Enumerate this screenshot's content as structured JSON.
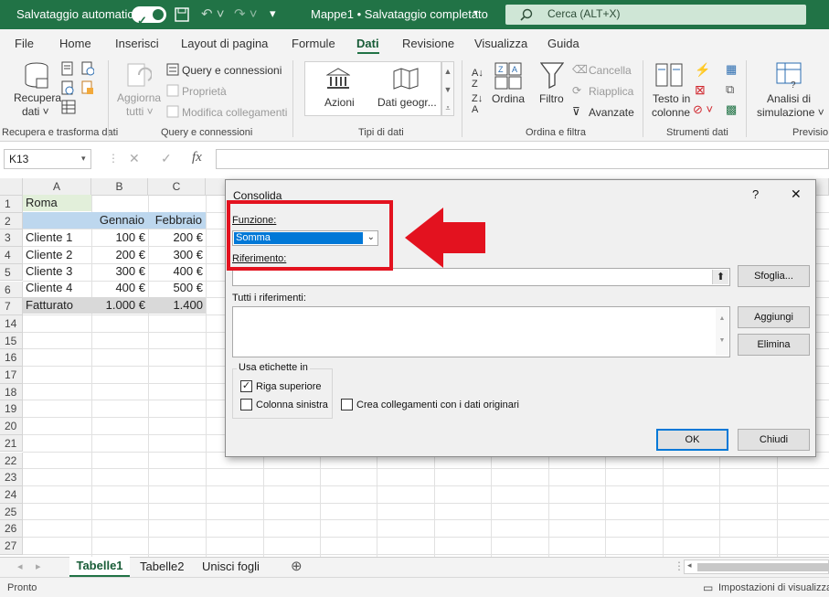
{
  "titlebar": {
    "autosave_label": "Salvataggio automatico",
    "doc_title": "Mappe1 • Salvataggio completato",
    "search_placeholder": "Cerca (ALT+X)",
    "colors": {
      "bar": "#217346"
    }
  },
  "tabs": [
    "File",
    "Home",
    "Inserisci",
    "Layout di pagina",
    "Formule",
    "Dati",
    "Revisione",
    "Visualizza",
    "Guida"
  ],
  "active_tab": "Dati",
  "ribbon": {
    "recupera": {
      "line1": "Recupera",
      "line2": "dati ˅"
    },
    "query": {
      "q1": "Query e connessioni",
      "q2": "Proprietà",
      "q3": "Modifica collegamenti",
      "agg1": "Aggiorna",
      "agg2": "tutti ˅"
    },
    "tipi": {
      "azioni": "Azioni",
      "geo": "Dati geogr..."
    },
    "sort": {
      "ordina": "Ordina",
      "filtro": "Filtro",
      "cancella": "Cancella",
      "riapplica": "Riapplica",
      "avanzate": "Avanzate"
    },
    "tools": {
      "testo1": "Testo in",
      "testo2": "colonne"
    },
    "analisi": {
      "line1": "Analisi di",
      "line2": "simulazione ˅"
    },
    "groups": [
      "Recupera e trasforma dati",
      "Query e connessioni",
      "Tipi di dati",
      "Ordina e filtra",
      "Strumenti dati",
      "Previsio"
    ]
  },
  "formula_bar": {
    "name_box": "K13",
    "cancel": "✕",
    "enter": "✓",
    "fx": "fx"
  },
  "grid": {
    "columns": [
      "A",
      "B",
      "C"
    ],
    "rows": [
      "1",
      "2",
      "3",
      "4",
      "5",
      "6",
      "7",
      "14",
      "15",
      "16",
      "17",
      "18",
      "19",
      "20",
      "21",
      "22",
      "23",
      "24",
      "25",
      "26",
      "27"
    ],
    "header_row": {
      "b": "Gennaio",
      "c": "Febbraio"
    },
    "a1": "Roma",
    "data": [
      {
        "a": "Cliente 1",
        "b": "100 €",
        "c": "200 €"
      },
      {
        "a": "Cliente 2",
        "b": "200 €",
        "c": "300 €"
      },
      {
        "a": "Cliente 3",
        "b": "300 €",
        "c": "400 €"
      },
      {
        "a": "Cliente 4",
        "b": "400 €",
        "c": "500 €"
      },
      {
        "a": "Fatturato",
        "b": "1.000 €",
        "c": "1.400"
      }
    ]
  },
  "sheets": {
    "tabs": [
      "Tabelle1",
      "Tabelle2",
      "Unisci fogli"
    ],
    "active": "Tabelle1"
  },
  "status": {
    "left": "Pronto",
    "right": "Impostazioni di visualizzaz"
  },
  "dialog": {
    "title": "Consolida",
    "help": "?",
    "close": "✕",
    "funzione_label": "Funzione:",
    "funzione_value": "Somma",
    "riferimento_label": "Riferimento:",
    "sfoglia": "Sfoglia...",
    "tutti_label": "Tutti i riferimenti:",
    "aggiungi": "Aggiungi",
    "elimina": "Elimina",
    "usa_label": "Usa etichette in",
    "riga_superiore": "Riga superiore",
    "colonna_sinistra": "Colonna sinistra",
    "crea_collegamenti": "Crea collegamenti con i dati originari",
    "riga_checked": true,
    "colonna_checked": false,
    "crea_checked": false,
    "ok": "OK",
    "chiudi": "Chiudi",
    "highlight_color": "#e3121f",
    "selection_color": "#0078d7"
  }
}
